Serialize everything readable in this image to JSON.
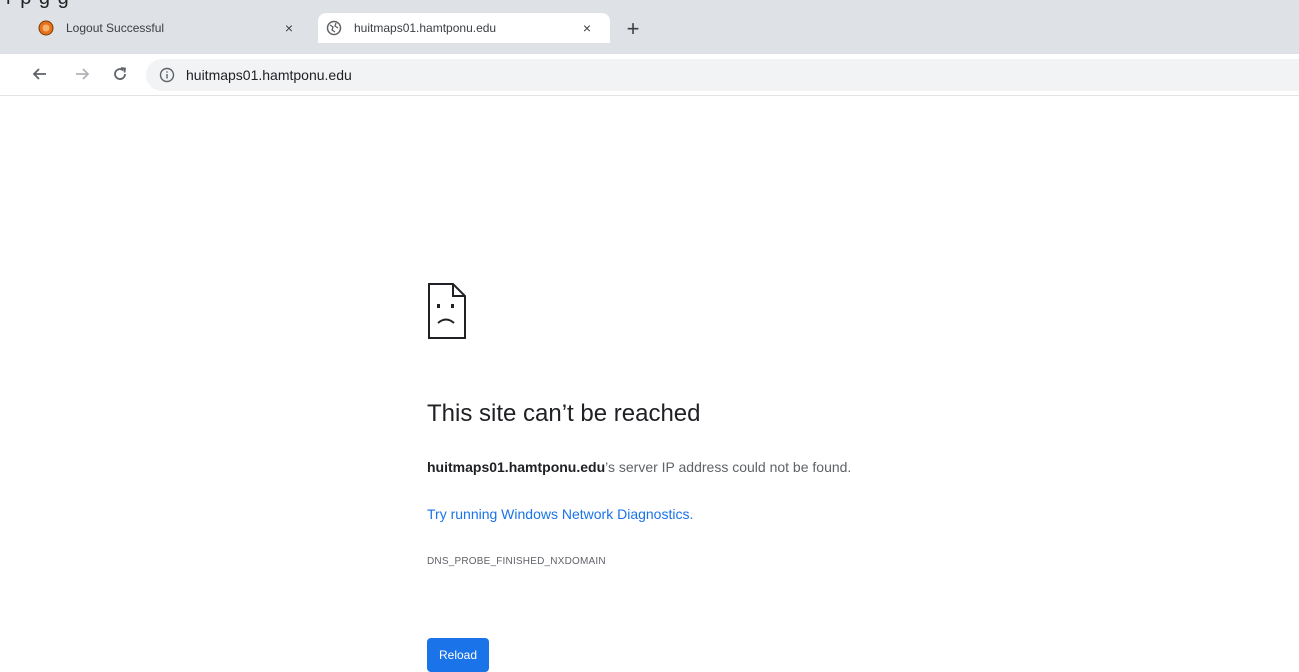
{
  "browser": {
    "tabs": [
      {
        "title": "Logout Successful",
        "icon": "orange-circle-favicon",
        "active": false
      },
      {
        "title": "huitmaps01.hamtponu.edu",
        "icon": "globe-icon",
        "active": true
      }
    ],
    "close_symbol": "×",
    "new_tab_symbol": "+",
    "toolbar": {
      "back_icon": "back-arrow-icon",
      "forward_icon": "forward-arrow-icon",
      "reload_icon": "reload-icon",
      "info_icon": "info-icon",
      "url": "huitmaps01.hamtponu.edu"
    },
    "accent_color": "#1a73e8"
  },
  "error_page": {
    "icon": "sad-page-icon",
    "title": "This site can’t be reached",
    "desc_host": "huitmaps01.hamtponu.edu",
    "desc_rest": "’s server IP address could not be found.",
    "link": "Try running Windows Network Diagnostics.",
    "code": "DNS_PROBE_FINISHED_NXDOMAIN",
    "reload_label": "Reload"
  }
}
